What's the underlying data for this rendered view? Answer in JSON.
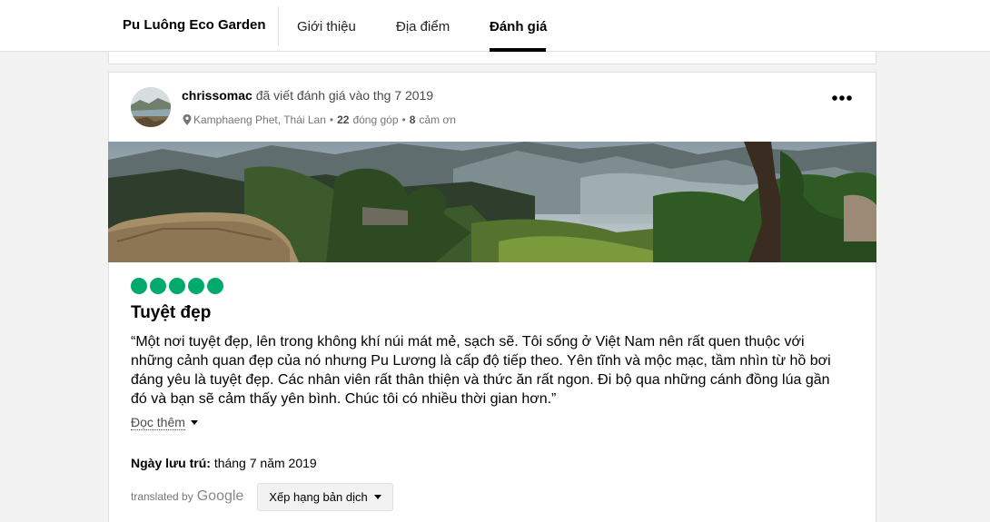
{
  "header": {
    "brand": "Pu Luông Eco Garden",
    "tabs": [
      {
        "label": "Giới thiệu",
        "active": false
      },
      {
        "label": "Địa điểm",
        "active": false
      },
      {
        "label": "Đánh giá",
        "active": true
      }
    ]
  },
  "review": {
    "username": "chrissomac",
    "wrote_text": "đã viết đánh giá vào thg 7 2019",
    "location": "Kamphaeng Phet, Thái Lan",
    "separator": "•",
    "contributions_count": "22",
    "contributions_label": "đóng góp",
    "helpful_count": "8",
    "helpful_label": "cảm ơn",
    "rating": 5,
    "title": "Tuyệt đẹp",
    "body": "“Một nơi tuyệt đẹp, lên trong không khí núi mát mẻ, sạch sẽ. Tôi sống ở Việt Nam nên rất quen thuộc với những cảnh quan đẹp của nó nhưng Pu Lương là cấp độ tiếp theo. Yên tĩnh và mộc mạc, tầm nhìn từ hồ bơi đáng yêu là tuyệt đẹp. Các nhân viên rất thân thiện và thức ăn rất ngon. Đi bộ qua những cánh đồng lúa gần đó và bạn sẽ cảm thấy yên bình. Chúc tôi có nhiều thời gian hơn.”",
    "read_more": "Đọc thêm",
    "stay_label": "Ngày lưu trú:",
    "stay_value": "tháng 7 năm 2019",
    "translated_by": "translated by",
    "google": "Google",
    "rate_translation": "Xếp hạng bản dịch"
  },
  "colors": {
    "rating_bubble": "#00aa6c",
    "underline": "#000000"
  },
  "icons": {
    "more": "more-horizontal-icon",
    "location": "map-pin-icon",
    "caret": "caret-down-icon"
  }
}
